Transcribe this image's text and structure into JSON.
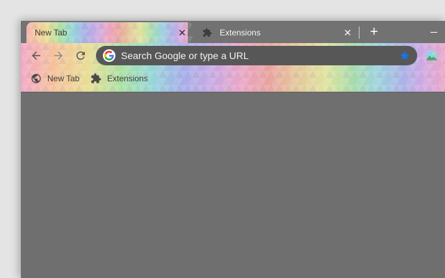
{
  "tabs": [
    {
      "title": "New Tab",
      "active": true,
      "close_glyph": "✕",
      "icon": "none"
    },
    {
      "title": "Extensions",
      "active": false,
      "close_glyph": "✕",
      "icon": "puzzle-icon"
    }
  ],
  "tabstrip": {
    "new_tab_glyph": "+",
    "minimize_icon": "minimize-icon"
  },
  "toolbar": {
    "back_icon": "arrow-left-icon",
    "forward_icon": "arrow-right-icon",
    "reload_icon": "reload-icon",
    "omnibox": {
      "value": "",
      "placeholder": "Search Google or type a URL",
      "provider_icon": "google-g-icon",
      "bookmark_icon": "star-icon",
      "bookmark_color": "#1a73e8"
    },
    "extension_icon": "image-icon"
  },
  "bookmarks": [
    {
      "label": "New Tab",
      "icon": "globe-icon"
    },
    {
      "label": "Extensions",
      "icon": "puzzle-icon"
    }
  ],
  "theme": {
    "style": "rainbow-triangles",
    "tabstrip_color": "#727272",
    "omnibox_color": "#575757",
    "content_color": "#6f6f6f"
  }
}
